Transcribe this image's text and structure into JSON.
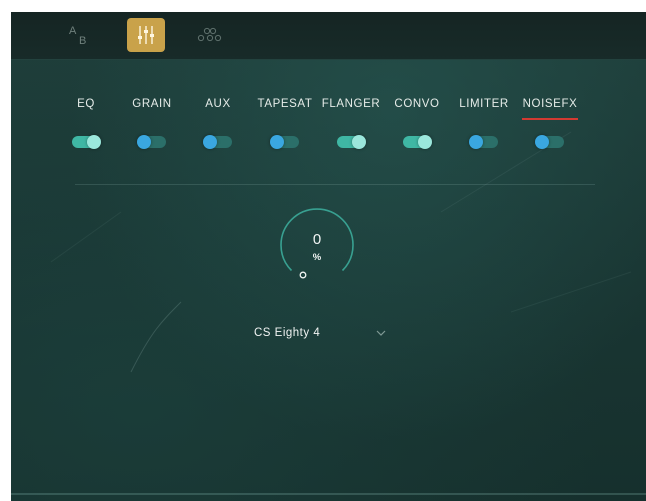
{
  "toolbar": {
    "ab_label_a": "A",
    "ab_label_b": "B",
    "icons": [
      "ab-compare-icon",
      "mixer-sliders-icon",
      "nodes-icon"
    ]
  },
  "tabs": [
    {
      "label": "EQ",
      "enabled": true
    },
    {
      "label": "GRAIN",
      "enabled": false
    },
    {
      "label": "AUX",
      "enabled": false
    },
    {
      "label": "TAPESAT",
      "enabled": false
    },
    {
      "label": "FLANGER",
      "enabled": true
    },
    {
      "label": "CONVO",
      "enabled": true
    },
    {
      "label": "LIMITER",
      "enabled": false
    },
    {
      "label": "NOISEFX",
      "enabled": false,
      "selected": true
    }
  ],
  "dial": {
    "value": "0",
    "unit": "%"
  },
  "preset": {
    "name": "CS Eighty 4",
    "dropdown_icon": "chevron-down-icon"
  },
  "colors": {
    "accent_gold": "#c9a24a",
    "toggle_on": "#3fb7a4",
    "toggle_off": "#2b6f69",
    "selected_underline": "#d33a32"
  }
}
